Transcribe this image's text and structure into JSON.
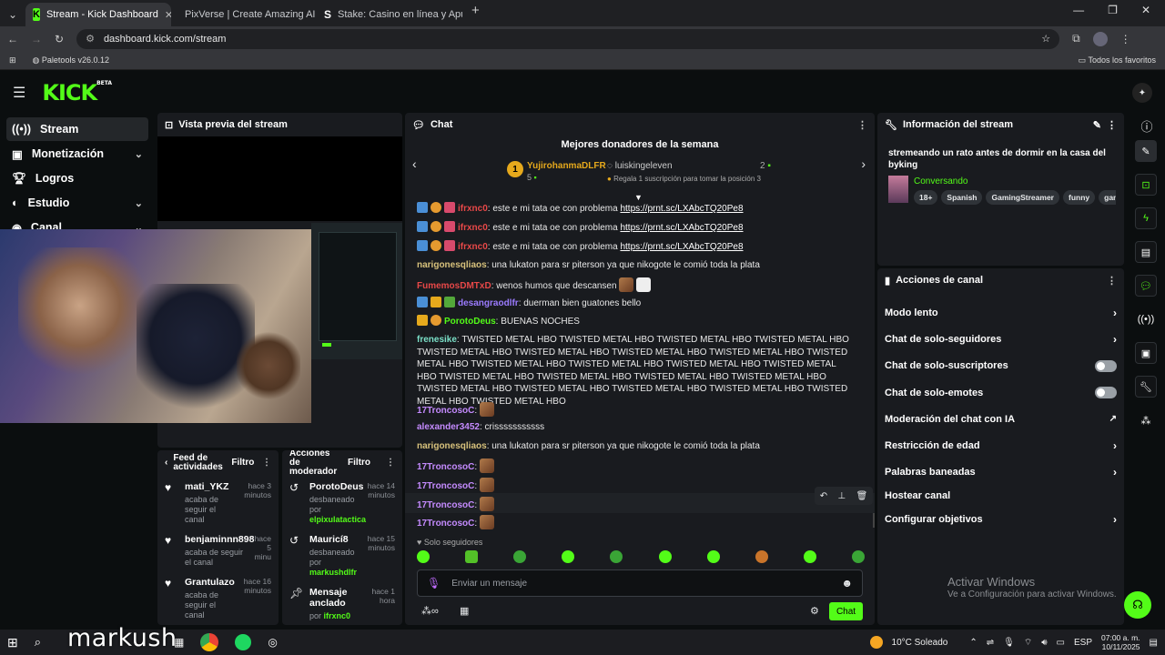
{
  "browser": {
    "tabs": [
      {
        "title": "Stream - Kick Dashboard"
      },
      {
        "title": "PixVerse | Create Amazing AI Vi"
      },
      {
        "title": "Stake: Casino en línea y Apuest"
      }
    ],
    "url": "dashboard.kick.com/stream",
    "bookmark": "Paletools v26.0.12",
    "favorites": "Todos los favoritos"
  },
  "logo": {
    "text": "KICK",
    "beta": "BETA"
  },
  "nav": [
    {
      "label": "Stream"
    },
    {
      "label": "Monetización"
    },
    {
      "label": "Logros"
    },
    {
      "label": "Estudio"
    },
    {
      "label": "Canal"
    }
  ],
  "preview": {
    "title": "Vista previa del stream"
  },
  "feed": {
    "title": "Feed de actividades",
    "filter": "Filtro",
    "items": [
      {
        "name": "mati_YKZ",
        "sub": "acaba de seguir el canal",
        "time": "hace 3 minutos"
      },
      {
        "name": "benjaminnn898",
        "sub": "acaba de seguir el canal",
        "time": "hace 5 minu"
      },
      {
        "name": "Grantulazo",
        "sub": "acaba de seguir el canal",
        "time": "hace 16 minutos"
      }
    ]
  },
  "mod": {
    "title": "Acciones de moderador",
    "filter": "Filtro",
    "items": [
      {
        "name": "PorotoDeus",
        "sub": "desbaneado por",
        "by": "elpixulatactica",
        "time": "hace 14 minutos"
      },
      {
        "name": "Mauricí8",
        "sub": "desbaneado por",
        "by": "markushdlfr",
        "time": "hace 15 minutos"
      },
      {
        "name": "Mensaje anclado",
        "sub": "por",
        "by": "ifrxnc0",
        "time": "hace 1 hora"
      }
    ]
  },
  "chat": {
    "title": "Chat",
    "donors_title": "Mejores donadores de la semana",
    "donor1": {
      "rank": "1",
      "name": "YujirohanmaDLFR",
      "count": "5"
    },
    "donor2": {
      "name": "luiskingeleven",
      "count": "2",
      "note": "Regala 1 suscripción para tomar la posición 3"
    },
    "messages": [
      {
        "user": "ifrxnc0",
        "text": "este e mi tata oe con problema",
        "link": "https://prnt.sc/LXAbcTQ20Pe8",
        "color": "#e84848"
      },
      {
        "user": "ifrxnc0",
        "text": "este e mi tata oe con problema",
        "link": "https://prnt.sc/LXAbcTQ20Pe8",
        "color": "#e84848"
      },
      {
        "user": "ifrxnc0",
        "text": "este e mi tata oe con problema",
        "link": "https://prnt.sc/LXAbcTQ20Pe8",
        "color": "#e84848"
      },
      {
        "user": "narigonesqliaos",
        "text": "una lukaton para sr piterson ya que nikogote le comió toda la plata",
        "color": "#d8c27c"
      },
      {
        "user": "FumemosDMTxD",
        "text": "wenos humos que descansen",
        "color": "#e84848"
      },
      {
        "user": "desangraodlfr",
        "text": "duerman bien guatones bello",
        "color": "#9b7bff"
      },
      {
        "user": "PorotoDeus",
        "text": "BUENAS NOCHES",
        "color": "#53fc18"
      },
      {
        "user": "frenesike",
        "text": "TWISTED METAL HBO TWISTED METAL HBO TWISTED METAL HBO TWISTED METAL HBO TWISTED METAL HBO TWISTED METAL HBO TWISTED METAL HBO TWISTED METAL HBO TWISTED METAL HBO TWISTED METAL HBO TWISTED METAL HBO TWISTED METAL HBO TWISTED METAL HBO TWISTED METAL HBO TWISTED METAL HBO TWISTED METAL HBO TWISTED METAL HBO TWISTED METAL HBO TWISTED METAL HBO TWISTED METAL HBO TWISTED METAL HBO TWISTED METAL HBO TWISTED METAL HBO",
        "color": "#7be0c8"
      },
      {
        "user": "17TroncosoC",
        "text": "",
        "color": "#c58bff"
      },
      {
        "user": "alexander3452",
        "text": "crisssssssssss",
        "color": "#c58bff"
      },
      {
        "user": "narigonesqliaos",
        "text": "una lukaton para sr piterson ya que nikogote le comió toda la plata",
        "color": "#d8c27c"
      },
      {
        "user": "17TroncosoC",
        "text": "",
        "color": "#c58bff"
      },
      {
        "user": "17TroncosoC",
        "text": "",
        "color": "#c58bff"
      },
      {
        "user": "17TroncosoC",
        "text": "",
        "color": "#c58bff"
      },
      {
        "user": "17TroncosoC",
        "text": "",
        "color": "#c58bff"
      }
    ],
    "followers_only": "Solo seguidores",
    "placeholder": "Enviar un mensaje",
    "send": "Chat"
  },
  "info": {
    "title": "Información del stream",
    "stream_title": "stremeando un rato antes de dormir en la casa del byking",
    "category": "Conversando",
    "tags": [
      "18+",
      "Spanish",
      "GamingStreamer",
      "funny",
      "gami"
    ]
  },
  "actions": {
    "title": "Acciones de canal",
    "rows": [
      {
        "label": "Modo lento",
        "kind": "arrow"
      },
      {
        "label": "Chat de solo-seguidores",
        "kind": "arrow"
      },
      {
        "label": "Chat de solo-suscriptores",
        "kind": "toggle"
      },
      {
        "label": "Chat de solo-emotes",
        "kind": "toggle"
      },
      {
        "label": "Moderación del chat con IA",
        "kind": "external"
      },
      {
        "label": "Restricción de edad",
        "kind": "arrow"
      },
      {
        "label": "Palabras baneadas",
        "kind": "arrow"
      },
      {
        "label": "Hostear canal",
        "kind": "none"
      },
      {
        "label": "Configurar objetivos",
        "kind": "arrow"
      }
    ]
  },
  "watermark": {
    "line1": "Activar Windows",
    "line2": "Ve a Configuración para activar Windows."
  },
  "overlay_name": "markush",
  "taskbar": {
    "weather": "10°C Soleado",
    "lang": "ESP",
    "time": "07:00 a. m.",
    "date": "10/11/2025"
  },
  "colors": {
    "accent": "#53fc18",
    "panel": "#191b1f",
    "bg": "#0b0e0f"
  }
}
